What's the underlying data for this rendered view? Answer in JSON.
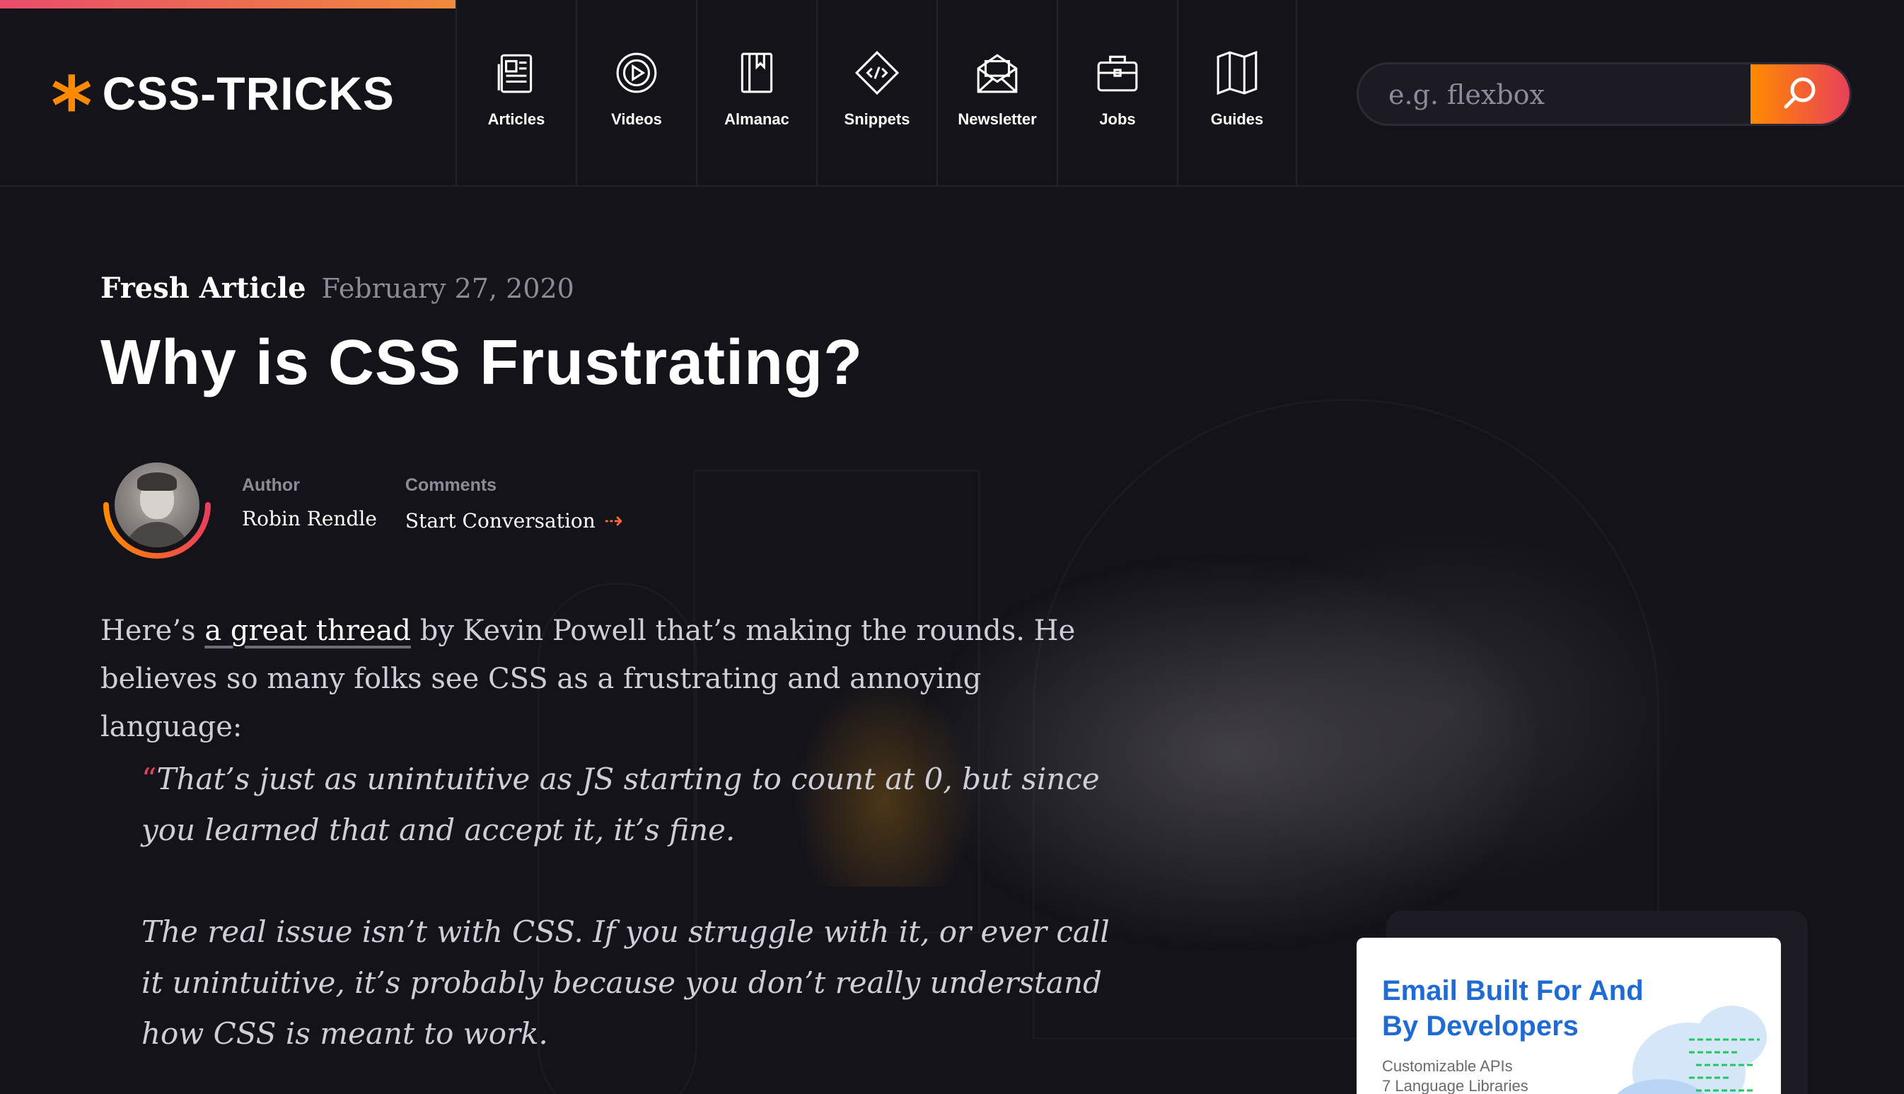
{
  "header": {
    "logo_text": "CSS-TRICKS",
    "nav": [
      {
        "label": "Articles",
        "icon": "newspaper-icon"
      },
      {
        "label": "Videos",
        "icon": "play-circle-icon"
      },
      {
        "label": "Almanac",
        "icon": "book-icon"
      },
      {
        "label": "Snippets",
        "icon": "code-diamond-icon"
      },
      {
        "label": "Newsletter",
        "icon": "envelope-icon"
      },
      {
        "label": "Jobs",
        "icon": "briefcase-icon"
      },
      {
        "label": "Guides",
        "icon": "map-icon"
      }
    ],
    "search": {
      "placeholder": "e.g. flexbox",
      "icon": "search-icon"
    }
  },
  "reading_progress": 0.24,
  "article": {
    "kicker": "Fresh Article",
    "date": "February 27, 2020",
    "title": "Why is CSS Frustrating?",
    "author_label": "Author",
    "author_name": "Robin Rendle",
    "comments_label": "Comments",
    "comments_link": "Start Conversation",
    "intro_before": "Here’s ",
    "intro_link": "a great thread",
    "intro_after": " by Kevin Powell that’s making the rounds. He believes so many folks see CSS as a frustrating and annoying language:",
    "quote_mark": "“",
    "quote_1": "That’s just as unintuitive as JS starting to count at 0, but since you learned that and accept it, it’s fine.",
    "quote_2": "The real issue isn’t with CSS. If you struggle with it, or ever call it unintuitive, it’s probably because you don’t really understand how CSS is meant to work."
  },
  "ad": {
    "headline": "Email Built For And By Developers",
    "line1": "Customizable APIs",
    "line2": "7 Language Libraries"
  },
  "colors": {
    "background": "#14131a",
    "accent_orange": "#ff8a00",
    "accent_pink": "#e8405a",
    "ad_blue": "#1e6bd6"
  }
}
